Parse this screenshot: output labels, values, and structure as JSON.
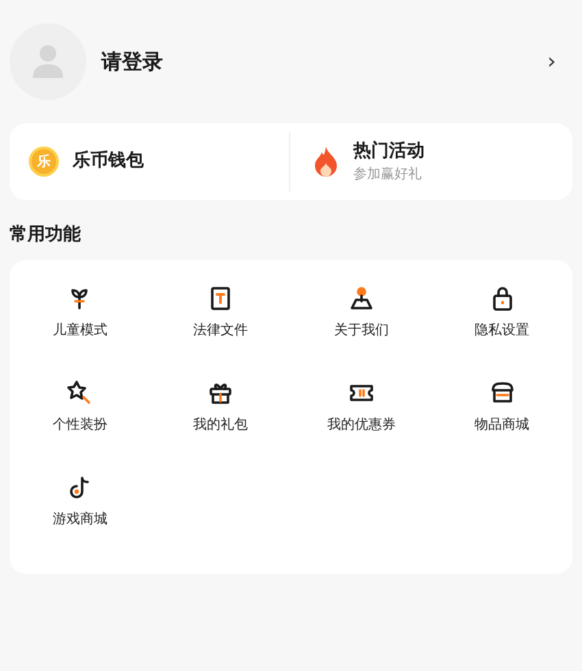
{
  "profile": {
    "title": "请登录",
    "chevron": "›"
  },
  "quick_cards": [
    {
      "kind": "coin",
      "coin_label": "乐",
      "title": "乐币钱包"
    },
    {
      "kind": "fire",
      "title": "热门活动",
      "subtitle": "参加赢好礼"
    }
  ],
  "section_title": "常用功能",
  "features": [
    {
      "kind": "sprout",
      "label": "儿童模式"
    },
    {
      "kind": "document",
      "label": "法律文件"
    },
    {
      "kind": "pin",
      "label": "关于我们"
    },
    {
      "kind": "lock",
      "label": "隐私设置"
    },
    {
      "kind": "wand",
      "label": "个性装扮"
    },
    {
      "kind": "gift",
      "label": "我的礼包"
    },
    {
      "kind": "ticket",
      "label": "我的优惠券"
    },
    {
      "kind": "store",
      "label": "物品商城"
    },
    {
      "kind": "note",
      "label": "游戏商城"
    }
  ]
}
